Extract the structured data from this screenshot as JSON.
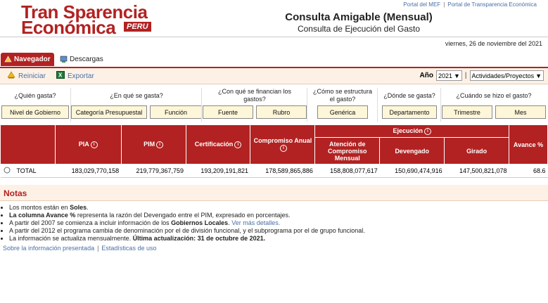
{
  "header": {
    "logo_line1": "Tran Sparencia",
    "logo_line2": "Económica",
    "logo_badge": "PERU",
    "title": "Consulta Amigable (Mensual)",
    "subtitle": "Consulta de Ejecución del Gasto",
    "top_links": [
      "Portal del MEF",
      "Portal de Transparencia Económica"
    ],
    "date": "viernes, 26 de noviembre del 2021"
  },
  "tabs": [
    {
      "label": "Navegador",
      "icon": "navigator-icon",
      "active": true
    },
    {
      "label": "Descargas",
      "icon": "downloads-icon",
      "active": false
    }
  ],
  "toolbar": {
    "reset_label": "Reiniciar",
    "export_label": "Exportar",
    "year_label": "Año",
    "year_value": "2021",
    "view_value": "Actividades/Proyectos"
  },
  "questions": [
    {
      "label": "¿Quién gasta?",
      "buttons": [
        "Nivel de Gobierno"
      ]
    },
    {
      "label": "¿En qué se gasta?",
      "buttons": [
        "Categoría Presupuestal",
        "Función"
      ]
    },
    {
      "label": "¿Con qué se financian los gastos?",
      "buttons": [
        "Fuente",
        "Rubro"
      ]
    },
    {
      "label": "¿Cómo se estructura el gasto?",
      "buttons": [
        "Genérica"
      ]
    },
    {
      "label": "¿Dónde se gasta?",
      "buttons": [
        "Departamento"
      ]
    },
    {
      "label": "¿Cuándo se hizo el gasto?",
      "buttons": [
        "Trimestre",
        "Mes"
      ]
    }
  ],
  "table": {
    "headers": {
      "pia": "PIA",
      "pim": "PIM",
      "certificacion": "Certificación",
      "compromiso": "Compromiso Anual",
      "ejecucion": "Ejecución",
      "atencion": "Atención de Compromiso Mensual",
      "devengado": "Devengado",
      "girado": "Girado",
      "avance": "Avance %"
    },
    "row": {
      "label": "TOTAL",
      "pia": "183,029,770,158",
      "pim": "219,779,367,759",
      "certificacion": "193,209,191,821",
      "compromiso": "178,589,865,886",
      "atencion": "158,808,077,617",
      "devengado": "150,690,474,916",
      "girado": "147,500,821,078",
      "avance": "68.6"
    }
  },
  "notas": {
    "title": "Notas",
    "items": [
      {
        "text": "Los montos están en ",
        "bold": "Soles",
        "tail": "."
      },
      {
        "text": "",
        "bold": "La columna Avance %",
        "tail": " representa la razón del Devengado entre el PIM, expresado en porcentajes."
      },
      {
        "text": "A partir del 2007 se comienza a incluir información de los ",
        "bold": "Gobiernos Locales",
        "tail": ".",
        "link": "Ver más detalles."
      },
      {
        "text": "A partir del 2012 el programa cambia de denominación por el de división funcional, y el subprograma por el de grupo funcional.",
        "bold": "",
        "tail": ""
      },
      {
        "text": "La información se actualiza mensualmente. ",
        "bold": "Última actualización: 31 de octubre de 2021.",
        "tail": ""
      }
    ],
    "footer_links": [
      "Sobre la información presentada",
      "Estadísticas de uso"
    ]
  },
  "colors": {
    "brand": "#b22222",
    "toolbar_bg": "#fdf1e6",
    "button_bg": "#fdf6d8",
    "link": "#4a6fa5"
  }
}
